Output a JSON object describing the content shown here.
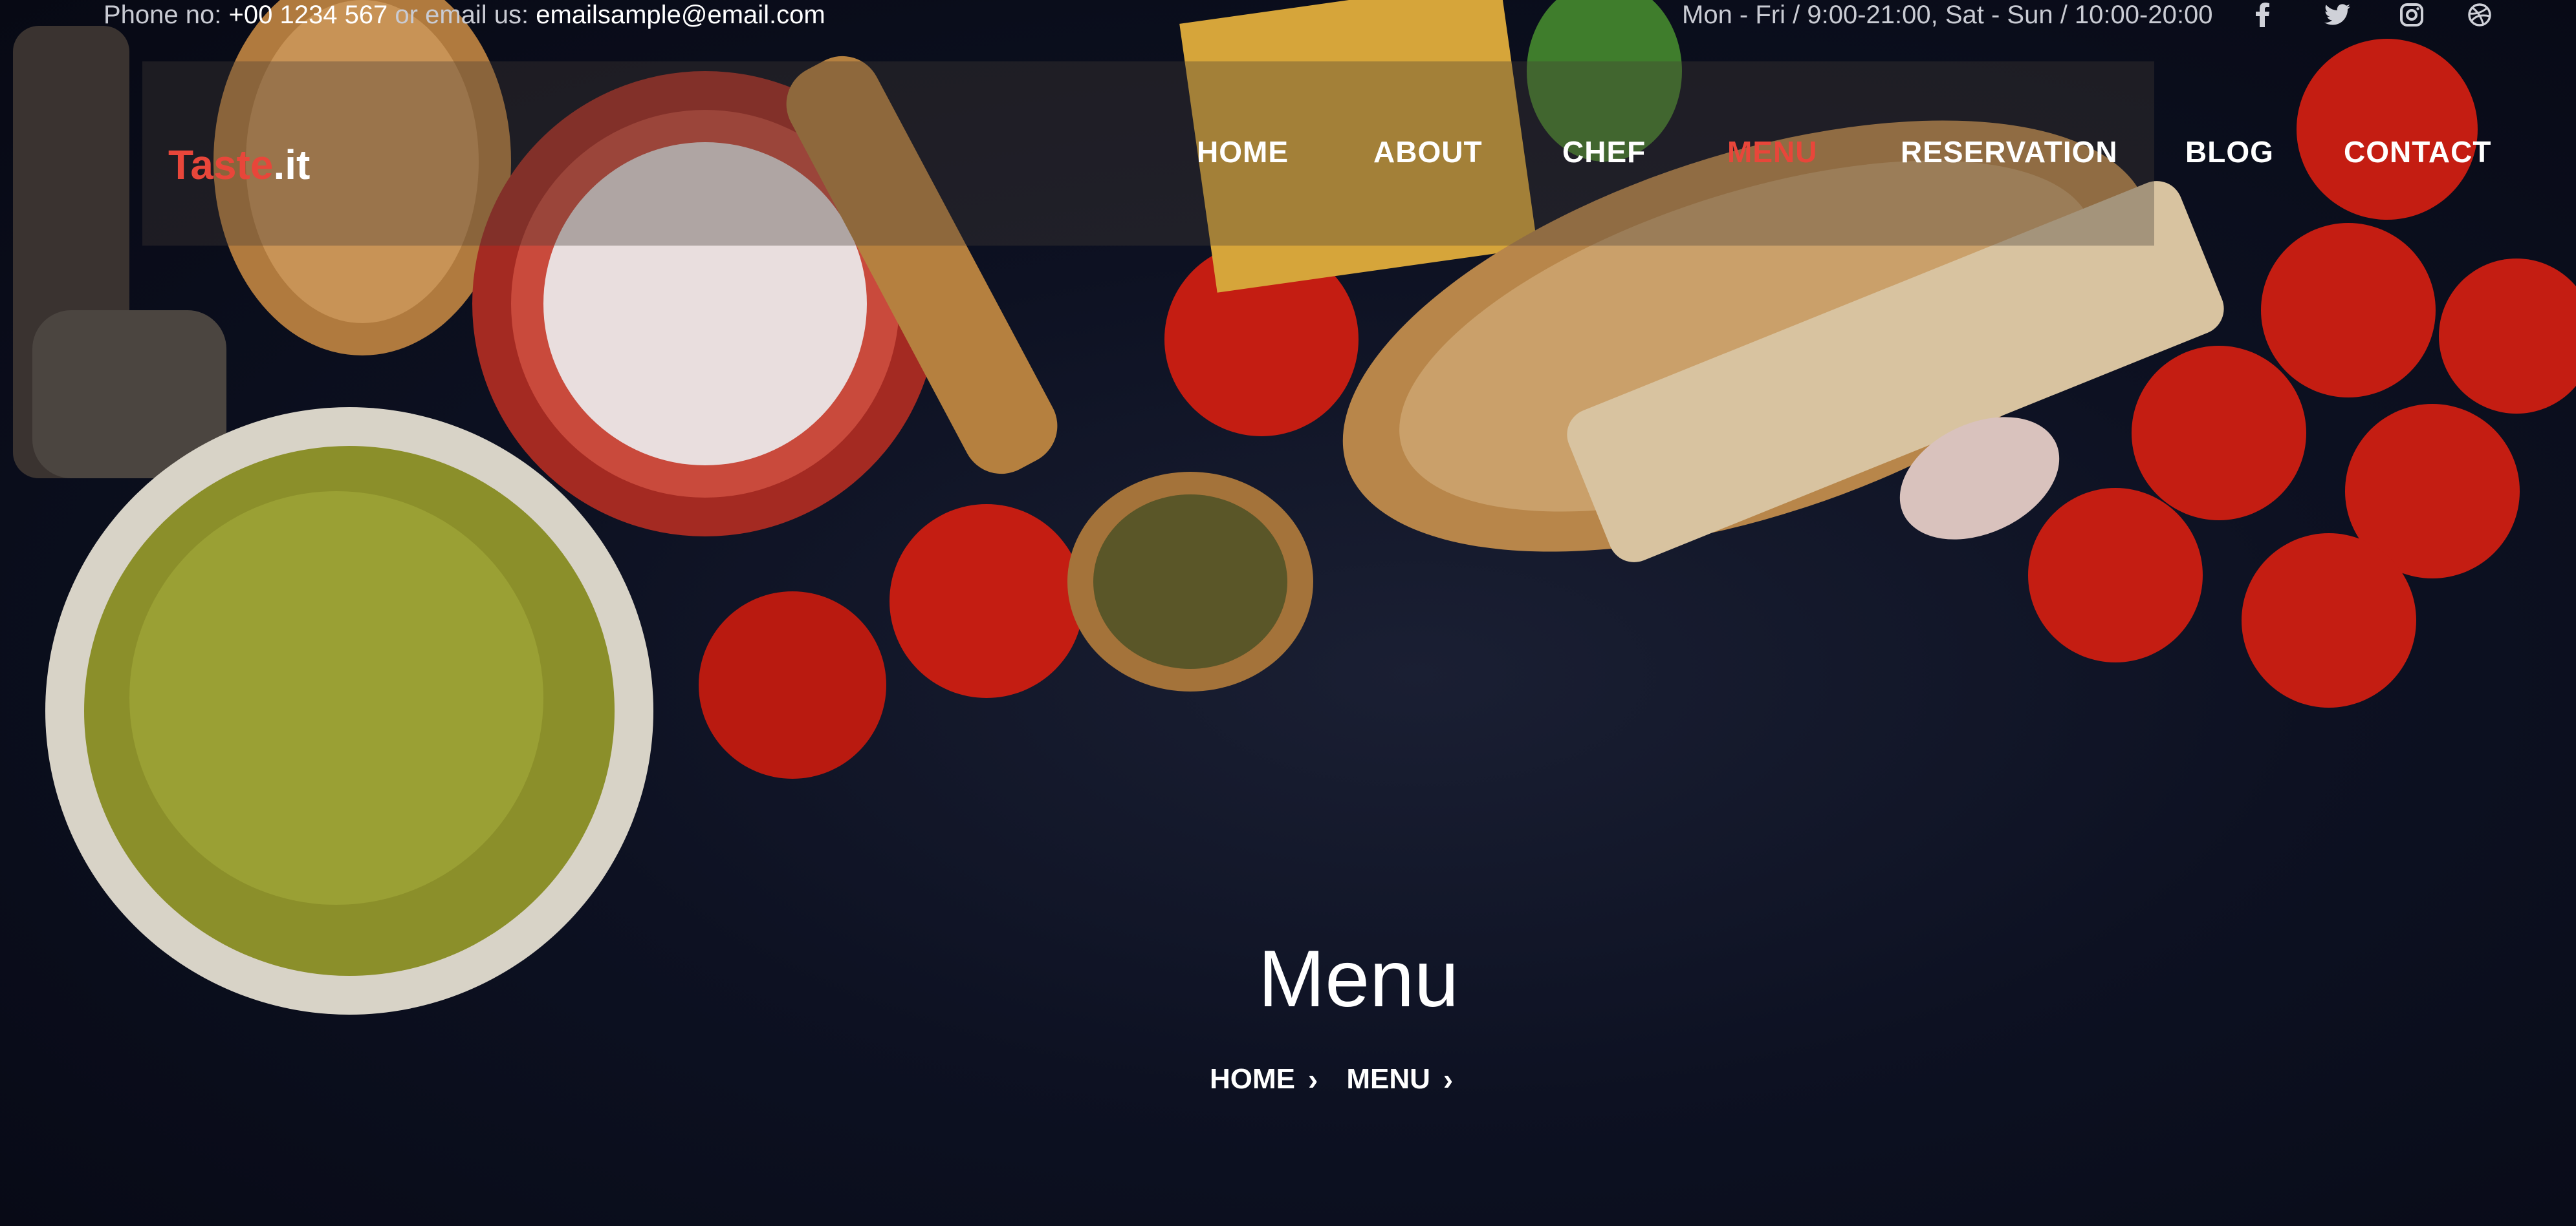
{
  "topbar": {
    "phone_prefix": "Phone no: ",
    "phone": "+00 1234 567",
    "email_prefix": " or email us: ",
    "email": "emailsample@email.com",
    "hours": "Mon - Fri / 9:00-21:00, Sat - Sun / 10:00-20:00",
    "social_icons": [
      "facebook-icon",
      "twitter-icon",
      "instagram-icon",
      "dribbble-icon"
    ]
  },
  "brand": {
    "part1": "Taste",
    "part2": ".it",
    "accent": "#e8463a"
  },
  "nav": {
    "items": [
      "HOME",
      "ABOUT",
      "CHEF",
      "MENU",
      "RESERVATION",
      "BLOG",
      "CONTACT"
    ],
    "active": "MENU"
  },
  "hero": {
    "title": "Menu",
    "breadcrumb": [
      "HOME",
      "MENU"
    ]
  }
}
